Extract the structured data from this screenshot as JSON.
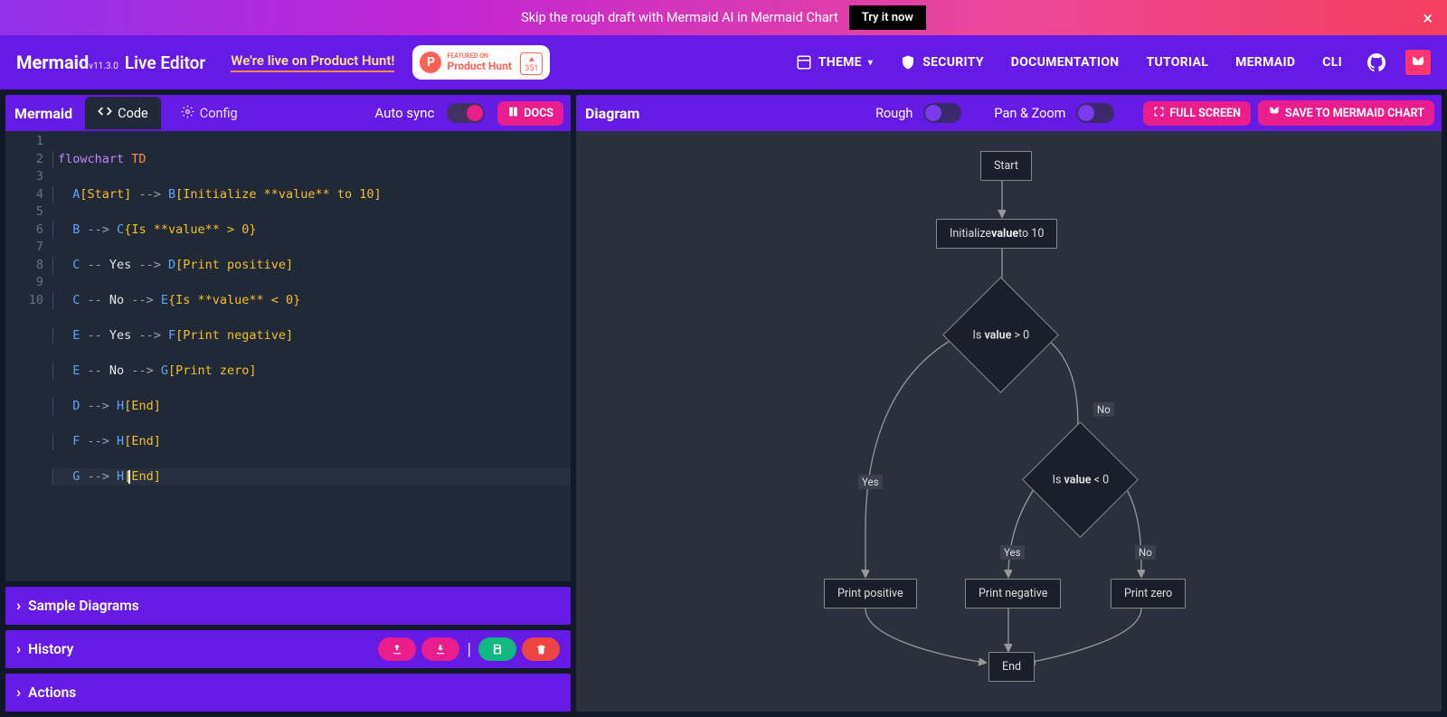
{
  "banner": {
    "text": "Skip the rough draft with Mermaid AI in Mermaid Chart",
    "button": "Try it now",
    "close": "×"
  },
  "topbar": {
    "logo": "Mermaid",
    "version": "v11.3.0",
    "subtitle": "Live Editor",
    "productHuntLink": "We're live on Product Hunt!",
    "phBadge": {
      "line1": "FEATURED ON",
      "line2": "Product Hunt",
      "count": "351"
    },
    "nav": {
      "theme": "THEME",
      "security": "SECURITY",
      "documentation": "DOCUMENTATION",
      "tutorial": "TUTORIAL",
      "mermaid": "MERMAID",
      "cli": "CLI"
    }
  },
  "editorPanel": {
    "title": "Mermaid",
    "tabCode": "Code",
    "tabConfig": "Config",
    "autoSync": "Auto sync",
    "docs": "DOCS",
    "lines": [
      {
        "n": "1"
      },
      {
        "n": "2"
      },
      {
        "n": "3"
      },
      {
        "n": "4"
      },
      {
        "n": "5"
      },
      {
        "n": "6"
      },
      {
        "n": "7"
      },
      {
        "n": "8"
      },
      {
        "n": "9"
      },
      {
        "n": "10"
      }
    ],
    "code": {
      "l1a": "flowchart",
      "l1b": "TD",
      "l2": {
        "a": "A",
        "a2": "[Start]",
        "arr": " --> ",
        "b": "B",
        "b2": "[Initialize **value** to 10]"
      },
      "l3": {
        "a": "B",
        "arr": " --> ",
        "b": "C",
        "b2": "{Is **value** > 0}"
      },
      "l4": {
        "a": "C",
        "dash": " -- ",
        "lbl": "Yes",
        "dash2": " --> ",
        "b": "D",
        "b2": "[Print positive]"
      },
      "l5": {
        "a": "C",
        "dash": " -- ",
        "lbl": "No",
        "dash2": " --> ",
        "b": "E",
        "b2": "{Is **value** < 0}"
      },
      "l6": {
        "a": "E",
        "dash": " -- ",
        "lbl": "Yes",
        "dash2": " --> ",
        "b": "F",
        "b2": "[Print negative]"
      },
      "l7": {
        "a": "E",
        "dash": " -- ",
        "lbl": "No",
        "dash2": " --> ",
        "b": "G",
        "b2": "[Print zero]"
      },
      "l8": {
        "a": "D",
        "arr": " --> ",
        "b": "H",
        "b2": "[End]"
      },
      "l9": {
        "a": "F",
        "arr": " --> ",
        "b": "H",
        "b2": "[End]"
      },
      "l10": {
        "a": "G",
        "arr": " --> ",
        "b": "H",
        "b2": "[End]"
      }
    }
  },
  "bottom": {
    "sample": "Sample Diagrams",
    "history": "History",
    "actions": "Actions"
  },
  "diagramPanel": {
    "title": "Diagram",
    "rough": "Rough",
    "panZoom": "Pan & Zoom",
    "fullScreen": "FULL SCREEN",
    "save": "SAVE TO MERMAID CHART",
    "nodes": {
      "start": "Start",
      "init1": "Initialize ",
      "init2": "value",
      "init3": " to 10",
      "c1": "Is ",
      "c2": "value",
      "c3": " > 0",
      "e1": "Is ",
      "e2": "value",
      "e3": " < 0",
      "d": "Print positive",
      "f": "Print negative",
      "g": "Print zero",
      "h": "End"
    },
    "labels": {
      "yes": "Yes",
      "no": "No"
    }
  },
  "chart_data": {
    "type": "flowchart",
    "direction": "TD",
    "nodes": [
      {
        "id": "A",
        "label": "Start",
        "shape": "rect"
      },
      {
        "id": "B",
        "label": "Initialize **value** to 10",
        "shape": "rect"
      },
      {
        "id": "C",
        "label": "Is **value** > 0",
        "shape": "diamond"
      },
      {
        "id": "D",
        "label": "Print positive",
        "shape": "rect"
      },
      {
        "id": "E",
        "label": "Is **value** < 0",
        "shape": "diamond"
      },
      {
        "id": "F",
        "label": "Print negative",
        "shape": "rect"
      },
      {
        "id": "G",
        "label": "Print zero",
        "shape": "rect"
      },
      {
        "id": "H",
        "label": "End",
        "shape": "rect"
      }
    ],
    "edges": [
      {
        "from": "A",
        "to": "B"
      },
      {
        "from": "B",
        "to": "C"
      },
      {
        "from": "C",
        "to": "D",
        "label": "Yes"
      },
      {
        "from": "C",
        "to": "E",
        "label": "No"
      },
      {
        "from": "E",
        "to": "F",
        "label": "Yes"
      },
      {
        "from": "E",
        "to": "G",
        "label": "No"
      },
      {
        "from": "D",
        "to": "H"
      },
      {
        "from": "F",
        "to": "H"
      },
      {
        "from": "G",
        "to": "H"
      }
    ]
  }
}
